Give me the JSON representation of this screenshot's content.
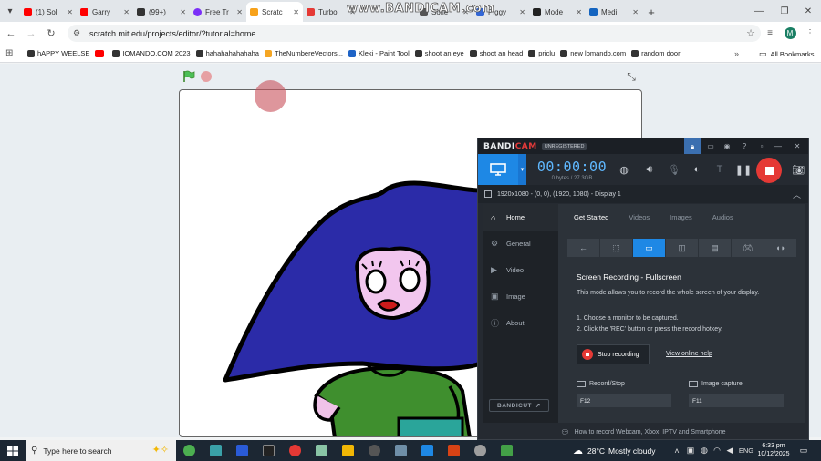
{
  "browser": {
    "tabs": [
      {
        "title": "(1) Sol",
        "color": "#ff0000"
      },
      {
        "title": "Garry",
        "color": "#ff0000"
      },
      {
        "title": "(99+)",
        "color": "#333333"
      },
      {
        "title": "Free Tr",
        "color": "#7b2ff7"
      },
      {
        "title": "Scratc",
        "color": "#f7a21b",
        "active": true
      },
      {
        "title": "Turbo",
        "color": "#e53935"
      },
      {
        "title": "Sofie",
        "color": "#555555"
      },
      {
        "title": "Piggy",
        "color": "#3367d6"
      },
      {
        "title": "Mode",
        "color": "#222222"
      },
      {
        "title": "Medi",
        "color": "#1565c0"
      }
    ],
    "url": "scratch.mit.edu/projects/editor/?tutorial=home",
    "profile_initial": "M",
    "bookmarks": [
      {
        "label": "hAPPY WEELSE",
        "color": "#333333"
      },
      {
        "label": "",
        "color": "#ff0000"
      },
      {
        "label": "IOMANDO.COM 2023",
        "color": "#333333"
      },
      {
        "label": "hahahahahahaha",
        "color": "#333333"
      },
      {
        "label": "TheNumbereVectors...",
        "color": "#f5a623"
      },
      {
        "label": "Kleki - Paint Tool",
        "color": "#1e63c6"
      },
      {
        "label": "shoot an eye",
        "color": "#333333"
      },
      {
        "label": "shoot an head",
        "color": "#333333"
      },
      {
        "label": "priclu",
        "color": "#333333"
      },
      {
        "label": "new lomando.com",
        "color": "#333333"
      },
      {
        "label": "random door",
        "color": "#333333"
      }
    ],
    "all_bookmarks": "All Bookmarks"
  },
  "watermark": "www.BANDICAM.com",
  "bandicam": {
    "logo_a": "BANDI",
    "logo_b": "CAM",
    "unregistered": "UNREGISTERED",
    "timer": "00:00:00",
    "size": "0 bytes / 27.3GB",
    "display": "1920x1080 - (0, 0), (1920, 1080) - Display 1",
    "nav": [
      "Home",
      "General",
      "Video",
      "Image",
      "About"
    ],
    "tabs": [
      "Get Started",
      "Videos",
      "Images",
      "Audios"
    ],
    "heading": "Screen Recording - Fullscreen",
    "description": "This mode allows you to record the whole screen of your display.",
    "step1": "1. Choose a monitor to be captured.",
    "step2": "2. Click the 'REC' button or press the record hotkey.",
    "stop_label": "Stop recording",
    "help_link": "View online help",
    "hotkey_record_label": "Record/Stop",
    "hotkey_record": "F12",
    "hotkey_image_label": "Image capture",
    "hotkey_image": "F11",
    "bandicut": "BANDICUT",
    "footer": "How to record Webcam, Xbox, IPTV and Smartphone"
  },
  "taskbar": {
    "search_placeholder": "Type here to search",
    "apps": [
      "#4caf50",
      "#3aa1a8",
      "#2a5bd7",
      "#222222",
      "#e53935",
      "#89c4a5",
      "#f2b705",
      "#555555",
      "#6f8fa8",
      "#1e88e5",
      "#d84315",
      "#9e9e9e",
      "#43a047"
    ],
    "temperature": "28°C",
    "weather": "Mostly cloudy",
    "language": "ENG",
    "time": "6:33 pm",
    "date": "10/12/2025"
  }
}
